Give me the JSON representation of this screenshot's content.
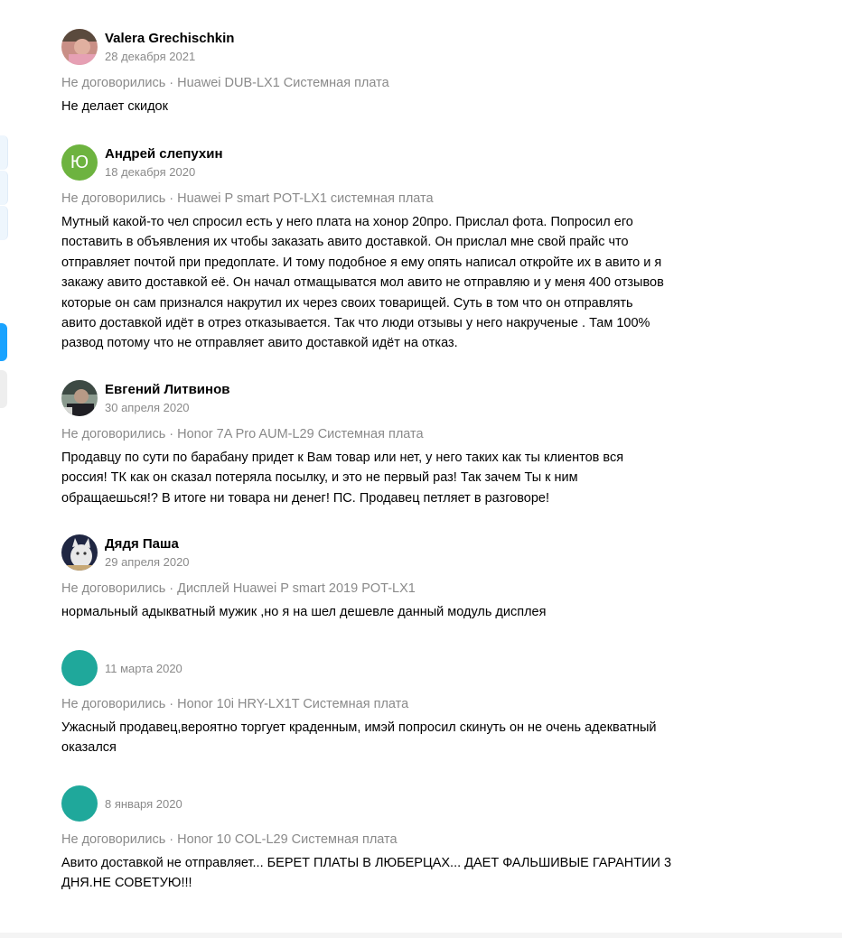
{
  "colors": {
    "meta_gray": "#8a8a8a",
    "avatar_green": "#6db33f",
    "avatar_teal": "#1fa89b",
    "edge_blue": "#1aa3ff"
  },
  "reviews": [
    {
      "author": "Valera Grechischkin",
      "avatar": "photo",
      "date": "28 декабря 2021",
      "meta": "Не договорились · Huawei DUB-LX1 Системная плата",
      "text_lines": [
        "Не делает скидок"
      ]
    },
    {
      "author": "Андрей слепухин",
      "avatar": "letter",
      "avatar_letter": "Ю",
      "date": "18 декабря 2020",
      "meta": "Не договорились · Huawei P smart POT-LX1 системная плата",
      "text_lines": [
        "Мутный какой-то чел спросил есть у него плата на хонор 20про. Прислал фота. Попросил его",
        "поставить в объявления их чтобы заказать авито доставкой. Он прислал мне свой прайс что",
        "отправляет почтой при предоплате. И тому подобное я ему опять написал откройте их в авито и я",
        "закажу авито доставкой её. Он начал отмащыватся мол авито не отправляю и у меня 400 отзывов",
        "которые он сам признался накрутил их через своих товарищей. Суть в том что он отправлять",
        "авито доставкой идёт в отрез отказывается. Так что люди отзывы у него накрученые . Там 100%",
        "развод потому что не отправляет авито доставкой идёт на отказ."
      ]
    },
    {
      "author": "Евгений Литвинов",
      "avatar": "photo",
      "date": "30 апреля 2020",
      "meta": "Не договорились · Honor 7A Pro AUM-L29 Системная плата",
      "text_lines": [
        "Продавцу по сути по барабану придет к Вам товар или нет, у него таких как ты клиентов вся",
        "россия! ТК как он сказал потеряла посылку, и это не первый раз! Так зачем Ты к ним",
        "обращаешься!? В итоге ни товара ни денег! ПС. Продавец петляет в разговоре!"
      ]
    },
    {
      "author": "Дядя Паша",
      "avatar": "photo",
      "date": "29 апреля 2020",
      "meta": "Не договорились · Дисплей Huawei P smart 2019 POT-LX1",
      "text_lines": [
        "нормальный адыкватный мужик ,но я на шел дешевле данный модуль дисплея"
      ]
    },
    {
      "author": "",
      "avatar": "blank",
      "date": "11 марта 2020",
      "meta": "Не договорились · Honor 10i HRY-LX1T Системная плата",
      "text_lines": [
        "Ужасный продавец,вероятно торгует краденным, имэй попросил скинуть он не очень адекватный",
        "оказался"
      ]
    },
    {
      "author": "",
      "avatar": "blank",
      "date": "8 января 2020",
      "meta": "Не договорились · Honor 10 COL-L29 Системная плата",
      "text_lines": [
        "Авито доставкой не отправляет... БЕРЕТ ПЛАТЫ В ЛЮБЕРЦАХ... ДАЕТ ФАЛЬШИВЫЕ ГАРАНТИИ 3",
        "ДНЯ.НЕ СОВЕТУЮ!!!"
      ]
    }
  ]
}
